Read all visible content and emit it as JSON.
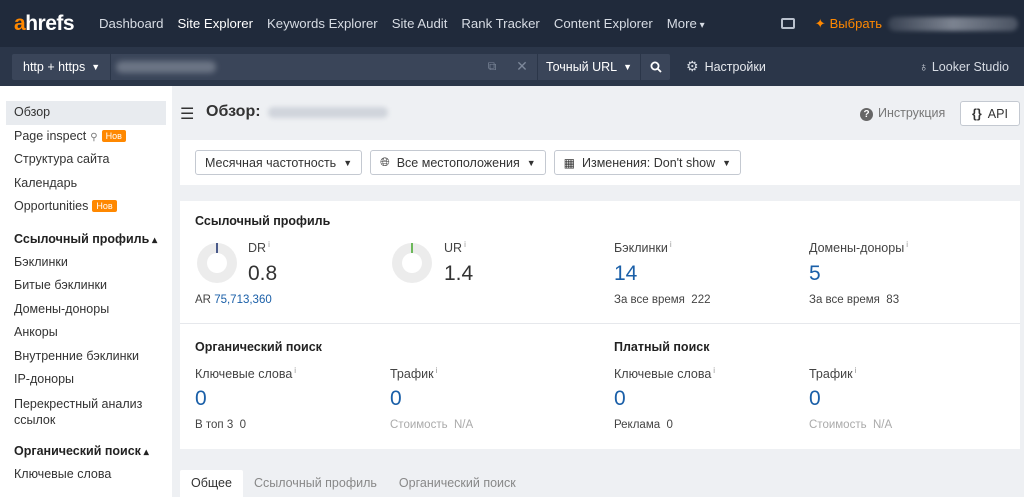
{
  "brand": {
    "logo_a": "a",
    "logo_rest": "hrefs",
    "accent": "#ff8800"
  },
  "nav": {
    "items": [
      "Dashboard",
      "Site Explorer",
      "Keywords Explorer",
      "Site Audit",
      "Rank Tracker",
      "Content Explorer"
    ],
    "more": "More",
    "choose": "Выбрать"
  },
  "urlbar": {
    "protocol": "http + https",
    "mode": "Точный URL",
    "settings": "Настройки",
    "looker": "Looker Studio"
  },
  "sidebar": {
    "overview": "Обзор",
    "page_inspect": "Page inspect",
    "new_badge": "Нов",
    "structure": "Структура сайта",
    "calendar": "Календарь",
    "opportunities": "Opportunities",
    "backlink_head": "Ссылочный профиль",
    "backlink_items": [
      "Бэклинки",
      "Битые бэклинки",
      "Домены-доноры",
      "Анкоры",
      "Внутренние бэклинки",
      "IP-доноры"
    ],
    "cross": "Перекрестный анализ ссылок",
    "organic_head": "Органический поиск",
    "organic_items": [
      "Ключевые слова"
    ]
  },
  "header": {
    "title": "Обзор:",
    "help": "Инструкция",
    "api": "API"
  },
  "filters": {
    "frequency": "Месячная частотность",
    "location": "Все местоположения",
    "changes": "Изменения: Don't show"
  },
  "backlink_profile": {
    "title": "Ссылочный профиль",
    "dr_label": "DR",
    "dr_value": "0.8",
    "ar_label": "AR",
    "ar_value": "75,713,360",
    "ur_label": "UR",
    "ur_value": "1.4",
    "backlinks_label": "Бэклинки",
    "backlinks_value": "14",
    "backlinks_all_label": "За все время",
    "backlinks_all_value": "222",
    "domains_label": "Домены-доноры",
    "domains_value": "5",
    "domains_all_label": "За все время",
    "domains_all_value": "83",
    "info_mark": "i"
  },
  "organic": {
    "title": "Органический поиск",
    "kw_label": "Ключевые слова",
    "kw_value": "0",
    "top3_label": "В топ 3",
    "top3_value": "0",
    "traffic_label": "Трафик",
    "traffic_value": "0",
    "cost_label": "Стоимость",
    "cost_value": "N/A"
  },
  "paid": {
    "title": "Платный поиск",
    "kw_label": "Ключевые слова",
    "kw_value": "0",
    "ads_label": "Реклама",
    "ads_value": "0",
    "traffic_label": "Трафик",
    "traffic_value": "0",
    "cost_label": "Стоимость",
    "cost_value": "N/A"
  },
  "tabs": [
    "Общее",
    "Ссылочный профиль",
    "Органический поиск"
  ]
}
